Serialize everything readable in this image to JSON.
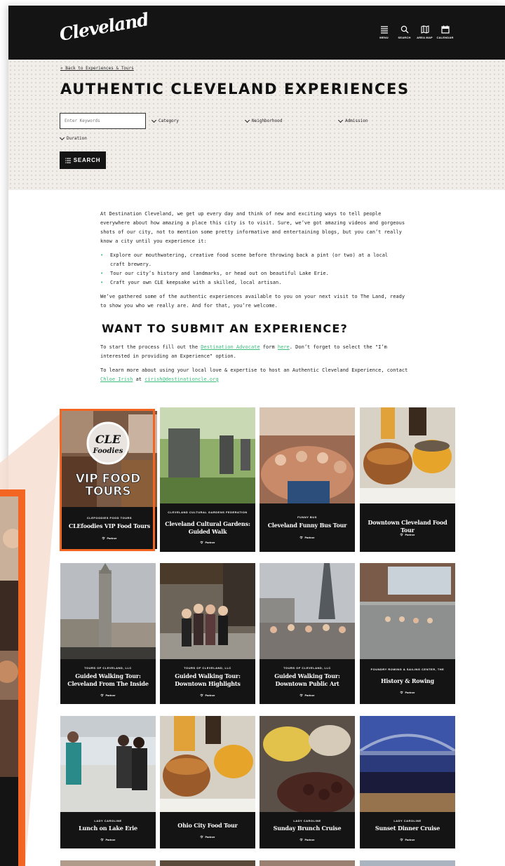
{
  "header": {
    "logo_text": "Cleveland",
    "nav": [
      {
        "label": "MENU",
        "icon": "menu-icon"
      },
      {
        "label": "SEARCH",
        "icon": "search-icon"
      },
      {
        "label": "AREA MAP",
        "icon": "map-icon"
      },
      {
        "label": "CALENDAR",
        "icon": "calendar-icon"
      }
    ]
  },
  "hero": {
    "back_link": "« Back to Experiences & Tours",
    "title": "AUTHENTIC CLEVELAND EXPERIENCES",
    "keywords_placeholder": "Enter Keywords",
    "filters": [
      "Category",
      "Neighborhood",
      "Admission",
      "Duration"
    ],
    "search_label": "SEARCH"
  },
  "intro": {
    "paragraph": "At Destination Cleveland, we get up every day and think of new and exciting ways to tell people everywhere about how amazing a place this city is to visit. Sure, we’ve got amazing videos and gorgeous shots of our city, not to mention some pretty informative and entertaining blogs, but you can’t really know a city until you experience it:",
    "bullets": [
      "Explore our mouthwatering, creative food scene before throwing back a pint (or two) at a local craft brewery.",
      "Tour our city’s history and landmarks, or head out on beautiful Lake Erie.",
      "Craft your own CLE keepsake with a skilled, local artisan."
    ],
    "closing": "We’ve gathered some of the authentic experiences available to you on your next visit to The Land, ready to show you who we really are. And for that, you’re welcome."
  },
  "submit": {
    "heading": "WANT TO SUBMIT AN EXPERIENCE?",
    "p1_a": "To start the process fill out the ",
    "p1_link1": "Destination Advocate",
    "p1_b": " form ",
    "p1_link2": "here",
    "p1_c": ". Don’t forget to select the \"I’m interested in providing an Experience\" option.",
    "p2_a": "To learn more about using your local love & expertise to host an Authentic Cleveland Experience, contact ",
    "p2_link1": "Chloe Irish",
    "p2_b": " at ",
    "p2_link2": "cirish@destinationcle.org"
  },
  "featured_image_text": {
    "line1": "CLE",
    "line2": "Foodies",
    "line3": "VIP FOOD",
    "line4": "TOURS"
  },
  "partner_label": "Partner",
  "cards": [
    {
      "tag": "CLEFOODIES FOOD TOURS",
      "title": "CLEfoodies VIP Food Tours",
      "image": "food-tour-photo"
    },
    {
      "tag": "CLEVELAND CULTURAL GARDENS FEDERATION",
      "title": "Cleveland Cultural Gardens: Guided Walk",
      "image": "gardens-photo"
    },
    {
      "tag": "FUNNY BUS",
      "title": "Cleveland Funny Bus Tour",
      "image": "bus-photo"
    },
    {
      "tag": "",
      "title": "Downtown Cleveland Food Tour",
      "image": "burger-photo"
    },
    {
      "tag": "TOURS OF CLEVELAND, LLC",
      "title": "Guided Walking Tour: Cleveland From The Inside",
      "image": "tower-photo"
    },
    {
      "tag": "TOURS OF CLEVELAND, LLC",
      "title": "Guided Walking Tour: Downtown Highlights",
      "image": "group-street-photo"
    },
    {
      "tag": "TOURS OF CLEVELAND, LLC",
      "title": "Guided Walking Tour: Downtown Public Art",
      "image": "public-art-photo"
    },
    {
      "tag": "FOUNDRY ROWING & SAILING CENTER, THE",
      "title": "History & Rowing",
      "image": "rowing-photo"
    },
    {
      "tag": "LADY CAROLINE",
      "title": "Lunch on Lake Erie",
      "image": "boat-deck-photo"
    },
    {
      "tag": "",
      "title": "Ohio City Food Tour",
      "image": "burger-photo-2"
    },
    {
      "tag": "LADY CAROLINE",
      "title": "Sunday Brunch Cruise",
      "image": "brunch-photo"
    },
    {
      "tag": "LADY CAROLINE",
      "title": "Sunset Dinner Cruise",
      "image": "bridge-night-photo"
    }
  ],
  "colors": {
    "accent_orange": "#f26522",
    "link_green": "#3cbc7c",
    "dark": "#141414"
  }
}
